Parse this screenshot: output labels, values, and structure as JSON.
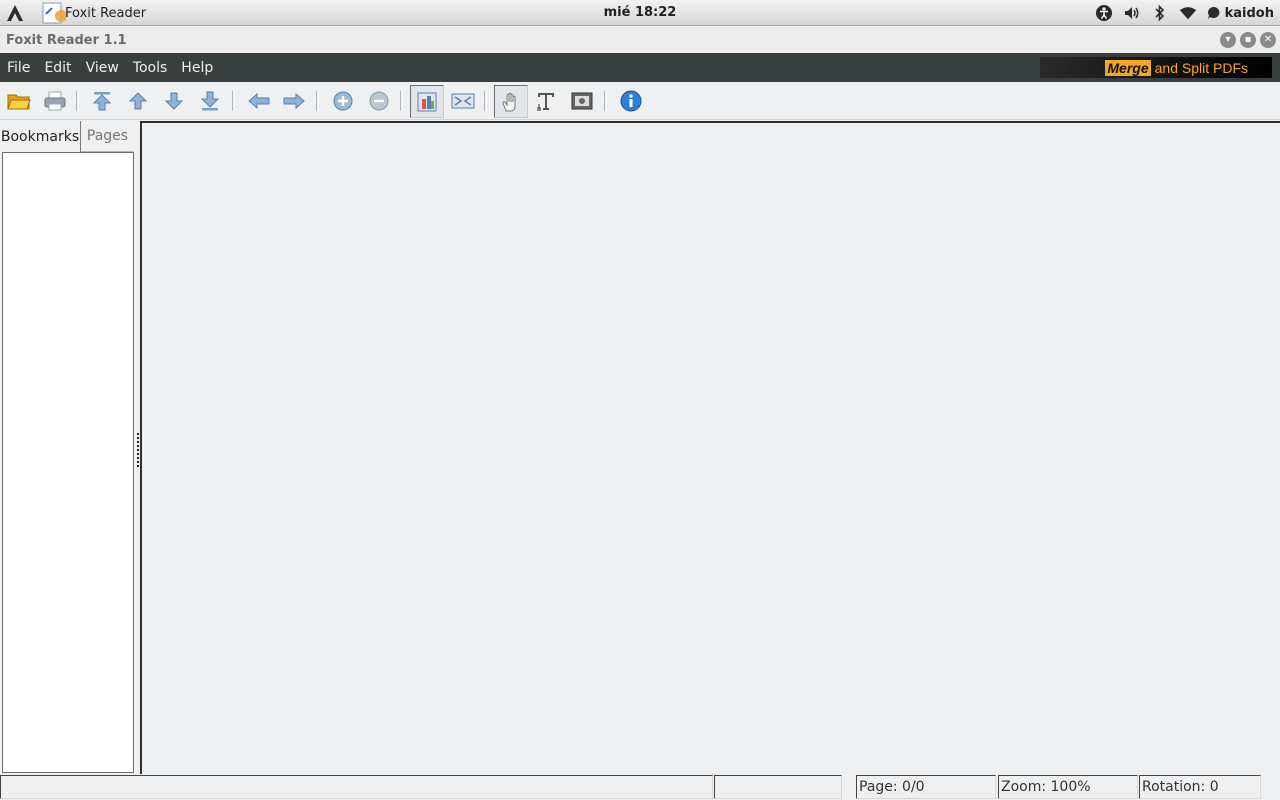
{
  "topbar": {
    "app_name": "Foxit Reader",
    "clock": "mié 18:22",
    "user": "kaidoh",
    "tray_icons": [
      "accessibility-icon",
      "volume-icon",
      "bluetooth-icon",
      "wifi-icon",
      "chat-status-icon"
    ]
  },
  "window": {
    "title": "Foxit Reader 1.1"
  },
  "menubar": {
    "items": [
      "File",
      "Edit",
      "View",
      "Tools",
      "Help"
    ],
    "ad": {
      "highlight": "Merge",
      "rest": "and Split PDFs"
    }
  },
  "toolbar": {
    "buttons": [
      "open-icon",
      "print-icon",
      "first-page-icon",
      "previous-page-icon",
      "next-page-icon",
      "last-page-icon",
      "back-icon",
      "forward-icon",
      "zoom-in-icon",
      "zoom-out-icon",
      "fit-page-icon",
      "fit-width-icon",
      "hand-tool-icon",
      "text-select-icon",
      "snapshot-icon",
      "about-icon"
    ]
  },
  "sidepane": {
    "tabs": [
      "Bookmarks",
      "Pages"
    ],
    "active_tab": "Bookmarks"
  },
  "statusbar": {
    "message": "",
    "field2": "",
    "page": "Page: 0/0",
    "zoom": "Zoom: 100%",
    "rotation": "Rotation: 0"
  },
  "colors": {
    "menubar_bg": "#393f3f",
    "content_bg": "#eef0f2",
    "ad_accent": "#f5a623"
  }
}
